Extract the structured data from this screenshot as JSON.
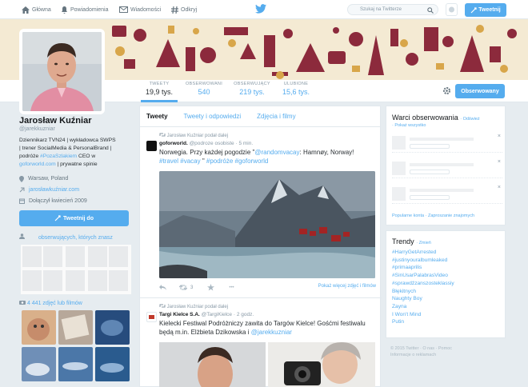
{
  "nav": {
    "home": "Główna",
    "notifications": "Powiadomienia",
    "messages": "Wiadomości",
    "discover": "Odkryj",
    "search_placeholder": "Szukaj na Twitterze",
    "tweet_button": "Tweetnij"
  },
  "profile": {
    "name": "Jarosław Kuźniar",
    "handle": "@jarekkuzniar",
    "bio_line1": "Dziennikarz TVN24 | wykładowca SWPS",
    "bio_line2": "| trener SocialMedia & PersonalBrand |",
    "bio_line3a": "podróże ",
    "bio_link1": "#PozaSzlakiem",
    "bio_line3b": " CEO w",
    "bio_link2": "goforworld.com",
    "bio_line4": " | prywatne spinie",
    "location": "Warsaw, Poland",
    "website": "jarosławkuźniar.com",
    "joined": "Dołączył kwiecień 2009",
    "tweet_to": "Tweetnij do",
    "followers_known": "obserwujących, których znasz",
    "photos_count": "4 441 zdjęć lub filmów"
  },
  "stats": [
    {
      "label": "TWEETY",
      "value": "19,9 tys."
    },
    {
      "label": "OBSERWOWANI",
      "value": "540"
    },
    {
      "label": "OBSERWUJĄCY",
      "value": "219 tys."
    },
    {
      "label": "ULUBIONE",
      "value": "15,6 tys."
    }
  ],
  "follow_button": "Obserwowany",
  "tabs": [
    "Tweety",
    "Tweety i odpowiedzi",
    "Zdjęcia i filmy"
  ],
  "tweets": [
    {
      "retweet_note": "Jarosław Kuźniar podał dalej",
      "author": "goforworld.",
      "author_handle": "@podroze osobiste",
      "time": "· 5 min.",
      "text": "Norwegia. Przy każdej pogodzie \"",
      "mention": "@randomvacay",
      "text2": ": Hamnøy, Norway!",
      "hashtag1": "#travel",
      "hashtag2": "#vacay",
      "mid": " \" ",
      "hashtag3": "#podróże",
      "hashtag4": "#goforworld",
      "retweet_count": "3",
      "more_photos": "Pokaż więcej zdjęć i filmów"
    },
    {
      "retweet_note": "Jarosław Kuźniar podał dalej",
      "author": "Targi Kielce S.A.",
      "author_handle": "@TargiKielce",
      "time": "· 2 godz.",
      "text": "Kielecki Festiwal Podróżniczy zawita do Targów Kielce! Gośćmi festiwalu będą m.in. Elżbieta Dzikowska i ",
      "mention": "@jarekkuzniar"
    }
  ],
  "who_to_follow": {
    "title": "Warci obserwowania",
    "refresh": "· Odśwież",
    "view_all": "· Pokaż wszystko",
    "popular": "Popularne konta",
    "invite": "· Zaproszanie znajomych"
  },
  "trends": {
    "title": "Trendy",
    "change": "· Zmień",
    "items": [
      "#HarryGetArrested",
      "#justinyouralbumleaked",
      "#primaaprilis",
      "#SinUsarPalabrasVideo",
      "#sprawdźzanszosteklassiy",
      "Błękitnych",
      "Naughty Boy",
      "Zayna",
      "I Won't Mind",
      "Putin"
    ]
  },
  "footer": {
    "line1": "© 2015 Twitter · O nas · Pomoc",
    "line2": "Informacje o reklamach"
  }
}
